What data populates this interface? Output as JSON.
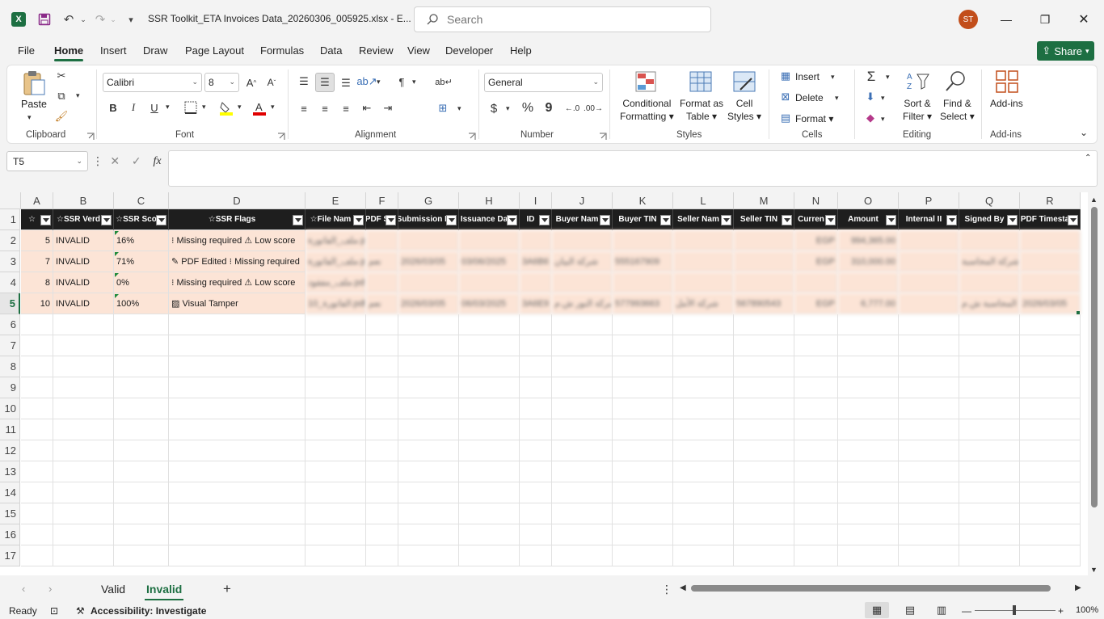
{
  "app": {
    "doc_title": "SSR Toolkit_ETA Invoices Data_20260306_005925.xlsx - E...",
    "search_placeholder": "Search",
    "avatar_initials": "ST",
    "brand_color": "#1d6f42"
  },
  "menu": {
    "tabs": [
      "File",
      "Home",
      "Insert",
      "Draw",
      "Page Layout",
      "Formulas",
      "Data",
      "Review",
      "View",
      "Developer",
      "Help"
    ],
    "active": "Home",
    "share_label": "Share"
  },
  "ribbon": {
    "clipboard": {
      "label": "Clipboard",
      "paste": "Paste"
    },
    "font": {
      "label": "Font",
      "family": "Calibri",
      "size": "8",
      "bold": "B",
      "italic": "I",
      "underline": "U"
    },
    "alignment": {
      "label": "Alignment"
    },
    "number": {
      "label": "Number",
      "format": "General",
      "currency": "$",
      "percent": "%",
      "comma": "9"
    },
    "styles": {
      "label": "Styles",
      "conditional_1": "Conditional",
      "conditional_2": "Formatting",
      "format_as_1": "Format as",
      "format_as_2": "Table",
      "cell_styles_1": "Cell",
      "cell_styles_2": "Styles"
    },
    "cells": {
      "label": "Cells",
      "insert": "Insert",
      "delete": "Delete",
      "format": "Format"
    },
    "editing": {
      "label": "Editing",
      "sort_1": "Sort &",
      "sort_2": "Filter",
      "find_1": "Find &",
      "find_2": "Select"
    },
    "addins": {
      "label": "Add-ins",
      "button": "Add-ins"
    }
  },
  "formula_bar": {
    "name_box": "T5",
    "fx": "fx",
    "value": ""
  },
  "grid": {
    "columns": [
      "A",
      "B",
      "C",
      "D",
      "E",
      "F",
      "G",
      "H",
      "I",
      "J",
      "K",
      "L",
      "M",
      "N",
      "O",
      "P",
      "Q",
      "R"
    ],
    "row_numbers": [
      "1",
      "2",
      "3",
      "4",
      "5",
      "6",
      "7",
      "8",
      "9",
      "10",
      "11",
      "12",
      "13",
      "14",
      "15",
      "16",
      "17"
    ],
    "headers": [
      "☆",
      "☆SSR Verd",
      "☆SSR Sco",
      "☆SSR Flags",
      "☆File Nam",
      "PDF S",
      "Submission D",
      "Issuance Da",
      "ID",
      "Buyer Nam",
      "Buyer TIN",
      "Seller Nam",
      "Seller TIN",
      "Curren",
      "Amount",
      "Internal II",
      "Signed By",
      "PDF Timesta"
    ],
    "rows": [
      {
        "a": "5",
        "b": "INVALID",
        "c": "16%",
        "d": "⁝ Missing required ⚠ Low score",
        "blurred": [
          "ملف_الفاتورة.pdf",
          "",
          "",
          "",
          "",
          "",
          "",
          "",
          "",
          "EGP",
          "994,365.00",
          "",
          "",
          ""
        ]
      },
      {
        "a": "7",
        "b": "INVALID",
        "c": "71%",
        "d": "✎ PDF Edited ⁝ Missing required",
        "blurred": [
          "ملف_الفاتورة.pdf",
          "نعم",
          "2026/03/05",
          "03/06/2025",
          "3A6B6",
          "شركة البيان",
          "555167909",
          "",
          "",
          "EGP",
          "310,000.00",
          "",
          "شركة المحاسبة",
          ""
        ]
      },
      {
        "a": "8",
        "b": "INVALID",
        "c": "0%",
        "d": "⁝ Missing required ⚠ Low score",
        "blurred": [
          "ملف_مفقود.pdf",
          "",
          "",
          "",
          "",
          "",
          "",
          "",
          "",
          "",
          "",
          "",
          "",
          ""
        ]
      },
      {
        "a": "10",
        "b": "INVALID",
        "c": "100%",
        "d": "▨ Visual Tamper",
        "blurred": [
          "الفاتورة_10.pdf",
          "نعم",
          "2026/03/05",
          "06/03/2025",
          "3A6E9",
          "شركة النور ش.م",
          "577993663",
          "شركة الأمل",
          "567890543",
          "EGP",
          "6,777.00",
          "",
          "شركة المحاسبة ش.م",
          "2026/03/05"
        ]
      }
    ]
  },
  "sheets": {
    "tabs": [
      "Valid",
      "Invalid"
    ],
    "active": "Invalid"
  },
  "status": {
    "ready": "Ready",
    "accessibility": "Accessibility: Investigate",
    "zoom": "100%"
  }
}
